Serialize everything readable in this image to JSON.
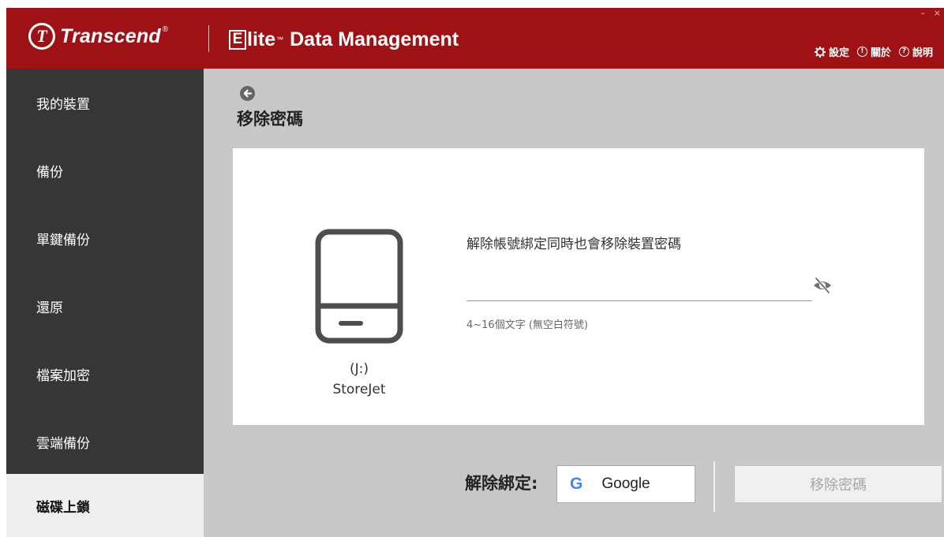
{
  "header": {
    "brand_mark": "T",
    "brand_name": "Transcend",
    "brand_reg": "®",
    "app_e": "E",
    "app_lite": "lite",
    "app_tm": "™",
    "app_rest": "Data Management",
    "window_controls": {
      "minimize": "–",
      "close": "×"
    },
    "menu": [
      {
        "icon": "gear-icon",
        "label": "設定"
      },
      {
        "icon": "info-icon",
        "glyph": "!",
        "label": "關於"
      },
      {
        "icon": "help-icon",
        "glyph": "?",
        "label": "說明"
      }
    ]
  },
  "sidebar": {
    "items": [
      {
        "label": "我的裝置",
        "active": false
      },
      {
        "label": "備份",
        "active": false
      },
      {
        "label": "單鍵備份",
        "active": false
      },
      {
        "label": "還原",
        "active": false
      },
      {
        "label": "檔案加密",
        "active": false
      },
      {
        "label": "雲端備份",
        "active": false
      },
      {
        "label": "磁碟上鎖",
        "active": true
      }
    ]
  },
  "main": {
    "title": "移除密碼",
    "device": {
      "letter": "(J:)",
      "name": "StoreJet"
    },
    "instruction": "解除帳號綁定同時也會移除裝置密碼",
    "password": {
      "value": "",
      "placeholder": ""
    },
    "hint": "4~16個文字 (無空白符號)",
    "unbind_label": "解除綁定:",
    "google_icon": "G",
    "google_label": "Google",
    "remove_button": "移除密碼",
    "remove_enabled": false
  },
  "colors": {
    "titlebar": "#9e1216",
    "sidebar": "#363636",
    "sidebar_active": "#efefef",
    "main_bg": "#c8c8c8",
    "google_blue": "#4285f4"
  }
}
